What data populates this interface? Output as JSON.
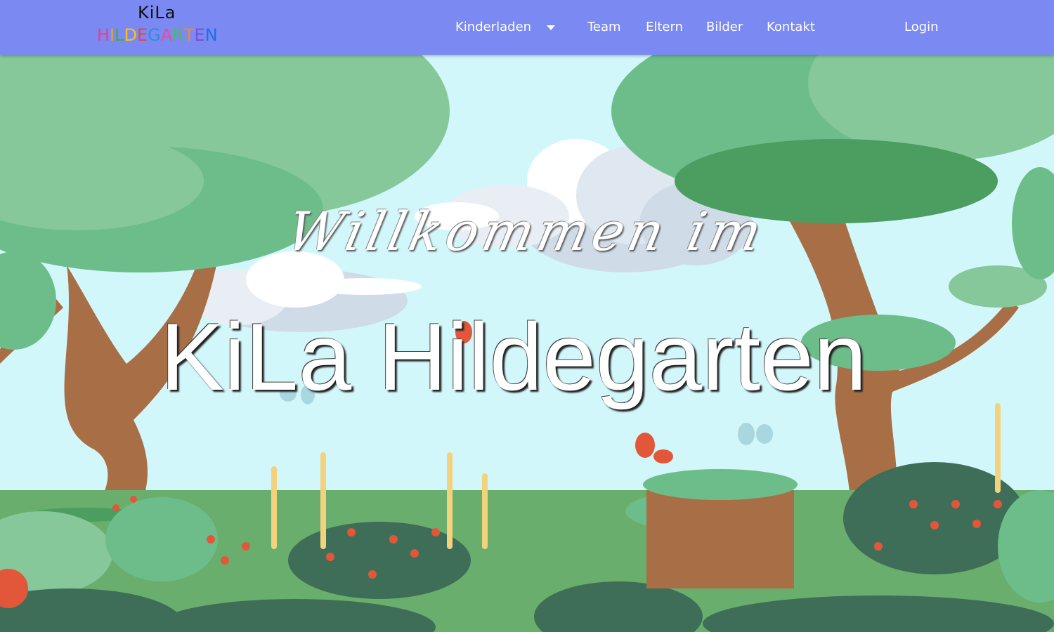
{
  "header": {
    "logo": {
      "top_text": "KiLa",
      "bottom_letters": [
        {
          "char": "H",
          "color": "#e83c8a"
        },
        {
          "char": "I",
          "color": "#f0a12a"
        },
        {
          "char": "L",
          "color": "#3fae3f"
        },
        {
          "char": "D",
          "color": "#f6c11e"
        },
        {
          "char": "E",
          "color": "#e64545"
        },
        {
          "char": "G",
          "color": "#2a8fe0"
        },
        {
          "char": "A",
          "color": "#e84d9b"
        },
        {
          "char": "R",
          "color": "#4dbb5a"
        },
        {
          "char": "T",
          "color": "#f08a2a"
        },
        {
          "char": "E",
          "color": "#7b4fd6"
        },
        {
          "char": "N",
          "color": "#1f6fe0"
        }
      ]
    },
    "nav": {
      "kinderladen": "Kinderladen",
      "team": "Team",
      "eltern": "Eltern",
      "bilder": "Bilder",
      "kontakt": "Kontakt",
      "login": "Login"
    }
  },
  "hero": {
    "welcome": "Willkommen im",
    "title": "KiLa Hildegarten"
  },
  "colors": {
    "navbar": "#7b8af3",
    "sky": "#d2f7fb",
    "foliage_light": "#86c89a",
    "foliage_mid": "#6dbd8a",
    "foliage_dark": "#3f6e58",
    "trunk": "#a86f47",
    "grass": "#6aae6e"
  },
  "icons": {
    "dropdown": "caret-down-icon"
  }
}
